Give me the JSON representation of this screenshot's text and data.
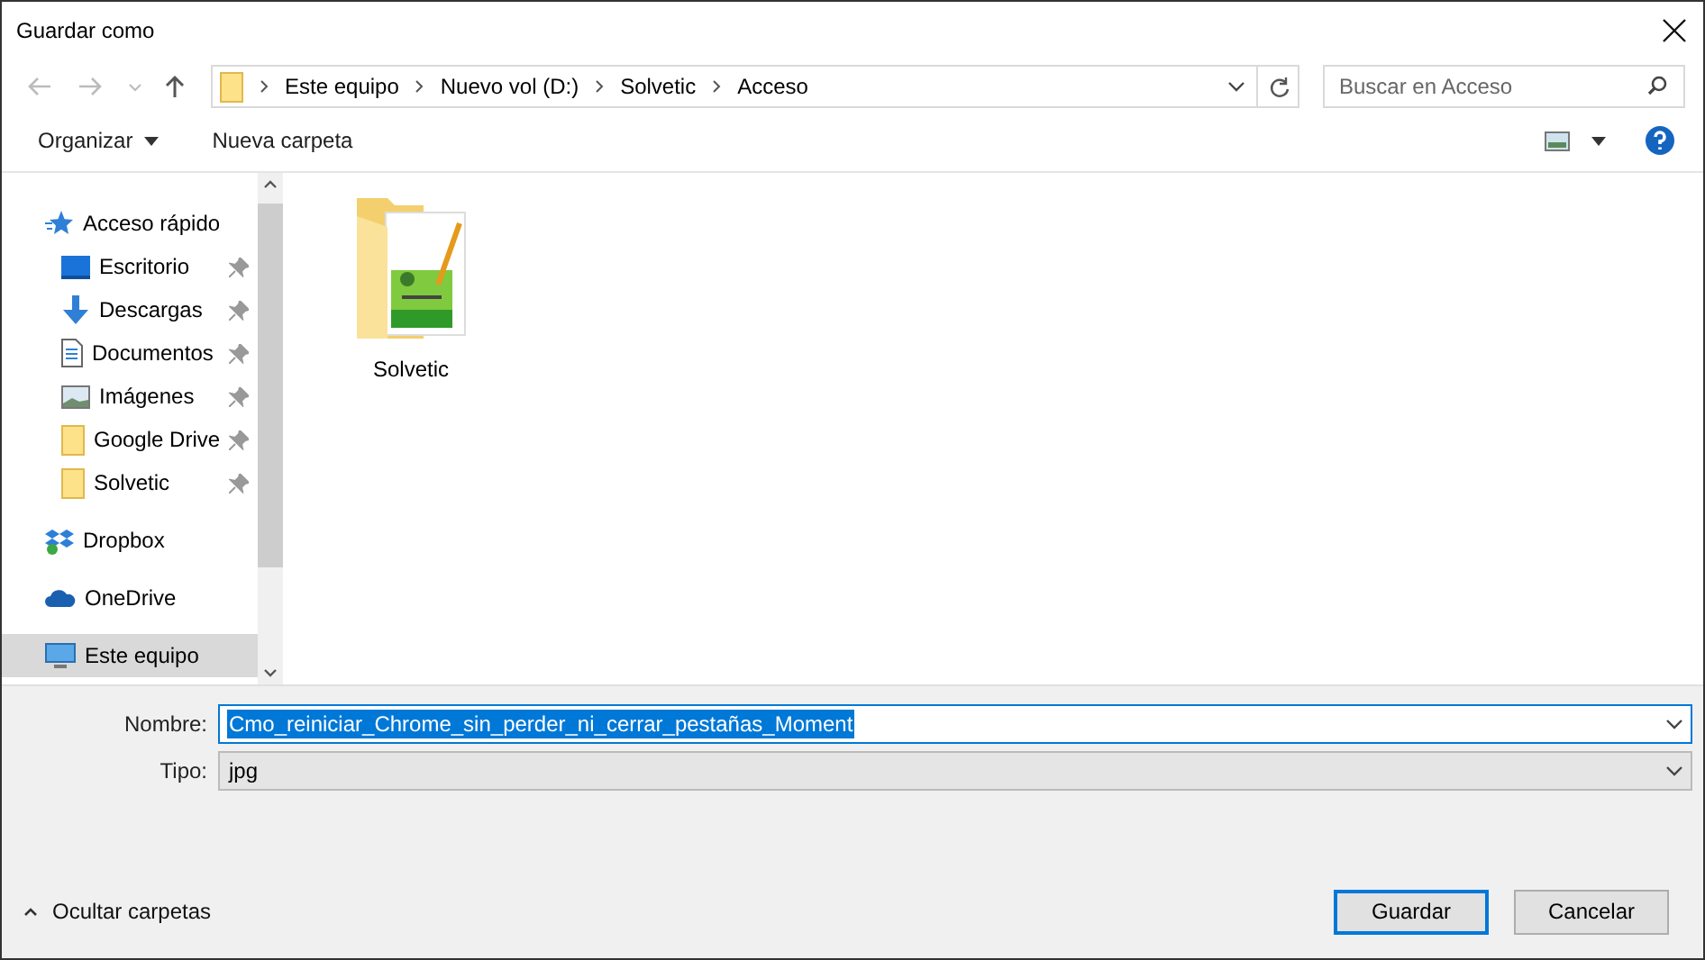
{
  "window": {
    "title": "Guardar como"
  },
  "address_bar": {
    "path": [
      "Este equipo",
      "Nuevo vol (D:)",
      "Solvetic",
      "Acceso"
    ]
  },
  "search": {
    "placeholder": "Buscar en Acceso"
  },
  "toolbar": {
    "organize": "Organizar",
    "new_folder": "Nueva carpeta"
  },
  "sidebar": {
    "items": [
      {
        "label": "Acceso rápido",
        "selected": false,
        "children": [
          {
            "label": "Escritorio",
            "pinned": true
          },
          {
            "label": "Descargas",
            "pinned": true
          },
          {
            "label": "Documentos",
            "pinned": true
          },
          {
            "label": "Imágenes",
            "pinned": true
          },
          {
            "label": "Google Drive",
            "pinned": true
          },
          {
            "label": "Solvetic",
            "pinned": true
          }
        ]
      },
      {
        "label": "Dropbox",
        "selected": false
      },
      {
        "label": "OneDrive",
        "selected": false
      },
      {
        "label": "Este equipo",
        "selected": true
      }
    ]
  },
  "files": [
    {
      "name": "Solvetic"
    }
  ],
  "form": {
    "name_label": "Nombre:",
    "name_value": "Cmo_reiniciar_Chrome_sin_perder_ni_cerrar_pestañas_Moment",
    "name_text_selected": true,
    "type_label": "Tipo:",
    "type_value": "jpg"
  },
  "footer": {
    "toggle": "Ocultar carpetas",
    "buttons": [
      {
        "label": "Guardar",
        "default": true
      },
      {
        "label": "Cancelar",
        "default": false
      }
    ]
  }
}
